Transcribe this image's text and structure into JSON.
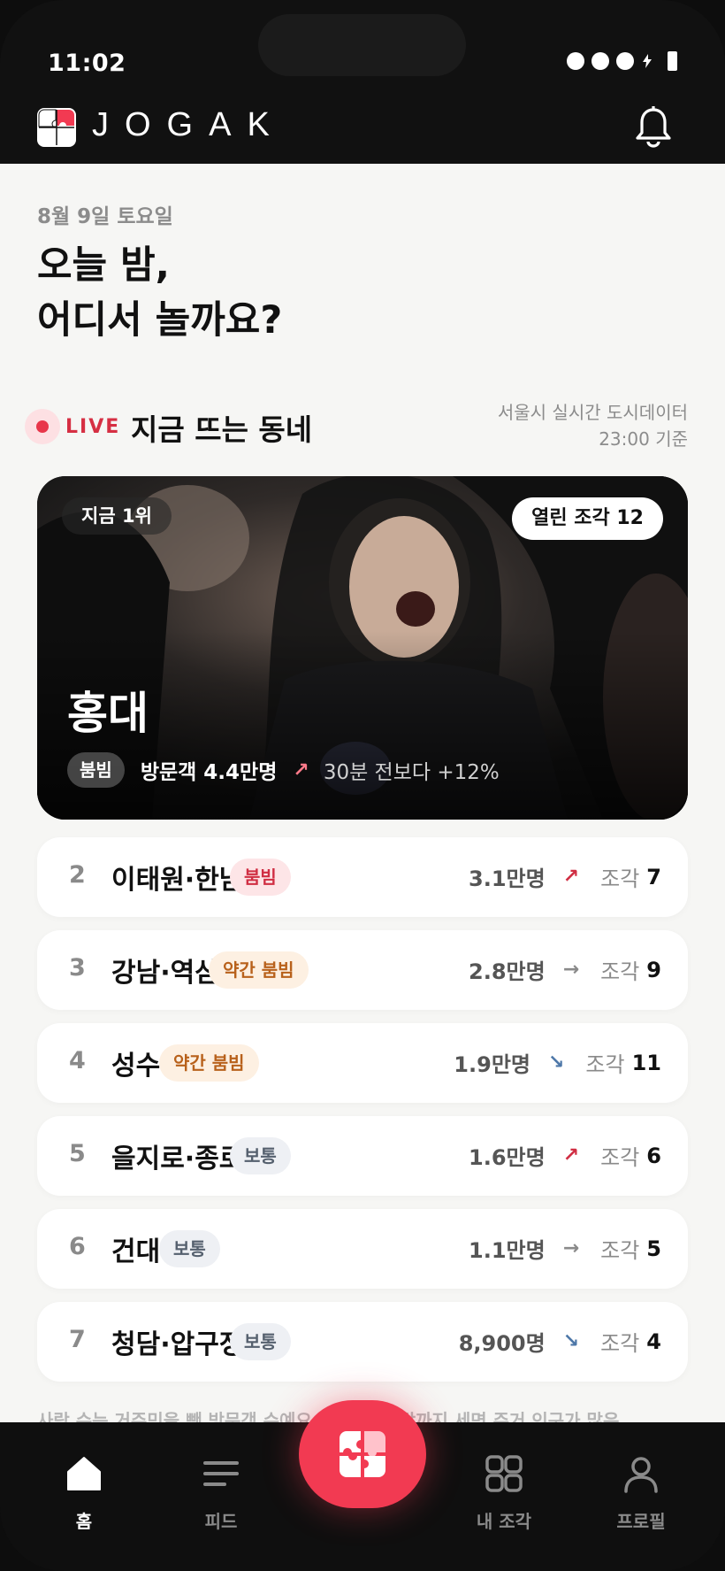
{
  "status_bar": {
    "time": "11:02"
  },
  "app": {
    "brand": "JOGAK"
  },
  "greeting": {
    "date": "8월 9일 토요일",
    "headline_line1": "오늘 밤,",
    "headline_line2": "어디서 놀까요?"
  },
  "live_section": {
    "live_label": "LIVE",
    "title": "지금 뜨는 동네",
    "source_line1": "서울시 실시간 도시데이터",
    "source_line2": "23:00 기준"
  },
  "hero": {
    "rank_label": "지금 1위",
    "open_pieces": "열린 조각 12",
    "name": "홍대",
    "crowd": "붐빔",
    "visitors": "방문객 4.4만명",
    "trend_arrow": "↗",
    "delta": "30분 전보다 +12%"
  },
  "rankings": [
    {
      "rank": "2",
      "name": "이태원·한남",
      "crowd": "붐빔",
      "crowd_level": "red",
      "count": "3.1만명",
      "trend": "↗",
      "trend_dir": "up",
      "piece_label": "조각",
      "pieces": "7"
    },
    {
      "rank": "3",
      "name": "강남·역삼",
      "crowd": "약간 붐빔",
      "crowd_level": "orange",
      "count": "2.8만명",
      "trend": "→",
      "trend_dir": "flat",
      "piece_label": "조각",
      "pieces": "9"
    },
    {
      "rank": "4",
      "name": "성수",
      "crowd": "약간 붐빔",
      "crowd_level": "orange",
      "count": "1.9만명",
      "trend": "↘",
      "trend_dir": "down",
      "piece_label": "조각",
      "pieces": "11"
    },
    {
      "rank": "5",
      "name": "을지로·종로",
      "crowd": "보통",
      "crowd_level": "gray",
      "count": "1.6만명",
      "trend": "↗",
      "trend_dir": "up",
      "piece_label": "조각",
      "pieces": "6"
    },
    {
      "rank": "6",
      "name": "건대",
      "crowd": "보통",
      "crowd_level": "gray",
      "count": "1.1만명",
      "trend": "→",
      "trend_dir": "flat",
      "piece_label": "조각",
      "pieces": "5"
    },
    {
      "rank": "7",
      "name": "청담·압구정",
      "crowd": "보통",
      "crowd_level": "gray",
      "count": "8,900명",
      "trend": "↘",
      "trend_dir": "down",
      "piece_label": "조각",
      "pieces": "4"
    }
  ],
  "footnote": "사람 수는 거주민을 뺀 방문객 수예요 ... 하는 사람까지 세면 주거 인구가 많은",
  "tabs": {
    "home": "홈",
    "feed": "피드",
    "my_pieces": "내 조각",
    "profile": "프로필"
  },
  "colors": {
    "accent": "#f23a52",
    "crowd_red": "#d02e43",
    "crowd_orange": "#b8611b",
    "trend_down": "#4d77a8"
  },
  "icons": {
    "logo": "puzzle-logo-icon",
    "bell": "bell-icon",
    "home": "home-icon",
    "feed": "feed-icon",
    "fab": "puzzle-icon",
    "my_pieces": "grid-icon",
    "profile": "person-icon"
  }
}
